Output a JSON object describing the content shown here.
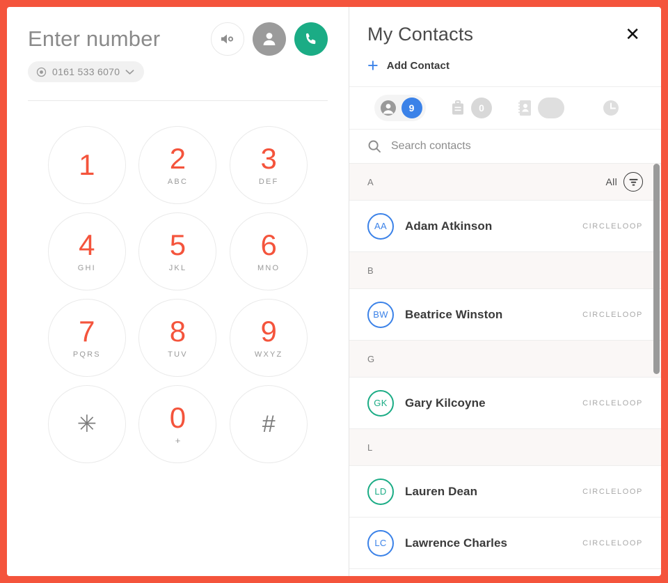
{
  "theme": {
    "frame_color": "#F4543C",
    "accent_red": "#F4543C",
    "accent_blue": "#3B82E8",
    "accent_teal": "#1BAC85",
    "gray_button": "#9B9B9B"
  },
  "dialer": {
    "title": "Enter number",
    "caller_id_number": "0161 533 6070",
    "caller_id_icon": "target-icon",
    "caller_id_chevron": "chevron-down-icon",
    "actions": [
      {
        "name": "speaker-button",
        "icon": "speaker-icon"
      },
      {
        "name": "contacts-button",
        "icon": "person-icon"
      },
      {
        "name": "call-button",
        "icon": "phone-icon"
      }
    ],
    "keys": [
      {
        "digit": "1",
        "letters": ""
      },
      {
        "digit": "2",
        "letters": "ABC"
      },
      {
        "digit": "3",
        "letters": "DEF"
      },
      {
        "digit": "4",
        "letters": "GHI"
      },
      {
        "digit": "5",
        "letters": "JKL"
      },
      {
        "digit": "6",
        "letters": "MNO"
      },
      {
        "digit": "7",
        "letters": "PQRS"
      },
      {
        "digit": "8",
        "letters": "TUV"
      },
      {
        "digit": "9",
        "letters": "WXYZ"
      },
      {
        "digit": "✳",
        "letters": ""
      },
      {
        "digit": "0",
        "letters": "+"
      },
      {
        "digit": "#",
        "letters": ""
      }
    ]
  },
  "contacts": {
    "title": "My Contacts",
    "close_label": "✕",
    "add_contact_label": "Add Contact",
    "add_contact_plus": "+",
    "tabs": [
      {
        "name": "tab-my-contacts",
        "icon": "person-circle-icon",
        "badge": "9",
        "badge_style": "blue",
        "active": true
      },
      {
        "name": "tab-company",
        "icon": "briefcase-icon",
        "badge": "0",
        "badge_style": "gray",
        "active": false
      },
      {
        "name": "tab-address-book",
        "icon": "address-book-icon",
        "badge": "",
        "badge_style": "empty",
        "active": false
      },
      {
        "name": "tab-recent",
        "icon": "clock-icon",
        "badge": null,
        "badge_style": "none",
        "active": false
      }
    ],
    "search": {
      "placeholder": "Search contacts",
      "value": "",
      "icon": "search-icon"
    },
    "filter": {
      "label": "All",
      "icon": "filter-icon"
    },
    "sections": [
      {
        "letter": "A",
        "has_filter": true,
        "rows": [
          {
            "initials": "AA",
            "name": "Adam Atkinson",
            "source": "CIRCLELOOP",
            "color": "blue"
          }
        ]
      },
      {
        "letter": "B",
        "has_filter": false,
        "rows": [
          {
            "initials": "BW",
            "name": "Beatrice Winston",
            "source": "CIRCLELOOP",
            "color": "blue"
          }
        ]
      },
      {
        "letter": "G",
        "has_filter": false,
        "rows": [
          {
            "initials": "GK",
            "name": "Gary Kilcoyne",
            "source": "CIRCLELOOP",
            "color": "teal"
          }
        ]
      },
      {
        "letter": "L",
        "has_filter": false,
        "rows": [
          {
            "initials": "LD",
            "name": "Lauren Dean",
            "source": "CIRCLELOOP",
            "color": "teal"
          },
          {
            "initials": "LC",
            "name": "Lawrence Charles",
            "source": "CIRCLELOOP",
            "color": "blue"
          }
        ]
      }
    ],
    "scrollbar": {
      "thumb_top_pct": 0,
      "thumb_height_pct": 51
    }
  }
}
